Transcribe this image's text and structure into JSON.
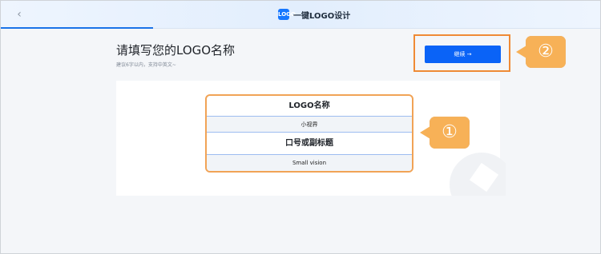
{
  "app": {
    "title": "一键LOGO设计",
    "logo_text": "LOGO",
    "back_glyph": "‹"
  },
  "header": {
    "title": "请填写您的LOGO名称",
    "hint": "建议6字以内，支持中英文~"
  },
  "actions": {
    "continue_label": "继续 →"
  },
  "preview": {
    "name_label": "LOGO名称",
    "name_value": "小视界",
    "slogan_label": "口号或副标题",
    "slogan_value": "Small vision"
  },
  "callouts": {
    "first": "①",
    "second": "②"
  },
  "colors": {
    "accent": "#0a63f7",
    "highlight": "#ef8a35",
    "callout": "#f7b157"
  },
  "progress": {
    "fraction": 0.25
  }
}
